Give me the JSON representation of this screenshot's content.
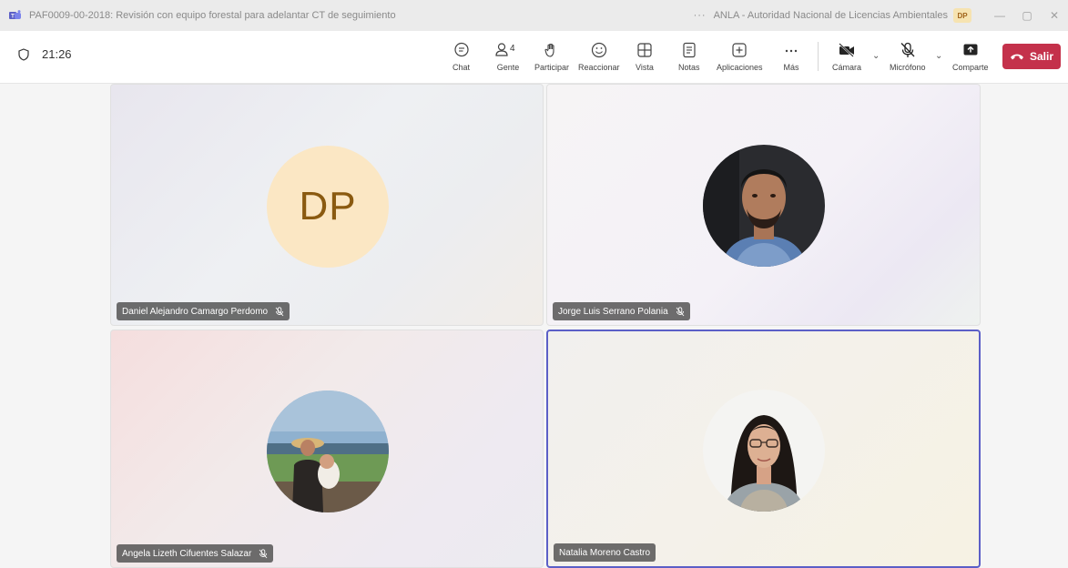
{
  "window": {
    "title": "PAF0009-00-2018: Revisión con equipo forestal para adelantar CT de seguimiento",
    "more": "···",
    "organization": "ANLA - Autoridad Nacional de Licencias Ambientales",
    "org_avatar": "DP",
    "minimize": "—",
    "restore": "▢",
    "close": "✕"
  },
  "toolbar": {
    "timer": "21:26",
    "chat_label": "Chat",
    "people_label": "Gente",
    "people_count": "4",
    "raise_label": "Participar",
    "react_label": "Reaccionar",
    "view_label": "Vista",
    "notes_label": "Notas",
    "apps_label": "Aplicaciones",
    "more_label": "Más",
    "camera_label": "Cámara",
    "mic_label": "Micrófono",
    "share_label": "Comparte",
    "leave_label": "Salir"
  },
  "participants": [
    {
      "name": "Daniel Alejandro Camargo Perdomo",
      "initials": "DP",
      "muted": true
    },
    {
      "name": "Jorge Luis Serrano Polania",
      "muted": true
    },
    {
      "name": "Angela Lizeth Cifuentes Salazar",
      "muted": true
    },
    {
      "name": "Natalia Moreno Castro",
      "muted": false,
      "speaking": true
    }
  ],
  "colors": {
    "leave": "#c4314b",
    "active_border": "#5b5fc7",
    "initials_bg": "#fbe7c4",
    "initials_text": "#8a5a10"
  },
  "icons": {
    "app": "teams-logo-icon",
    "timer": "shield-icon",
    "chat": "chat-icon",
    "people": "people-icon",
    "raise": "raise-hand-icon",
    "react": "smiley-icon",
    "view": "grid-icon",
    "notes": "notes-icon",
    "apps": "add-app-icon",
    "more": "ellipsis-icon",
    "camera": "camera-off-icon",
    "mic": "mic-off-icon",
    "share": "share-screen-icon",
    "leave": "phone-hangup-icon"
  }
}
